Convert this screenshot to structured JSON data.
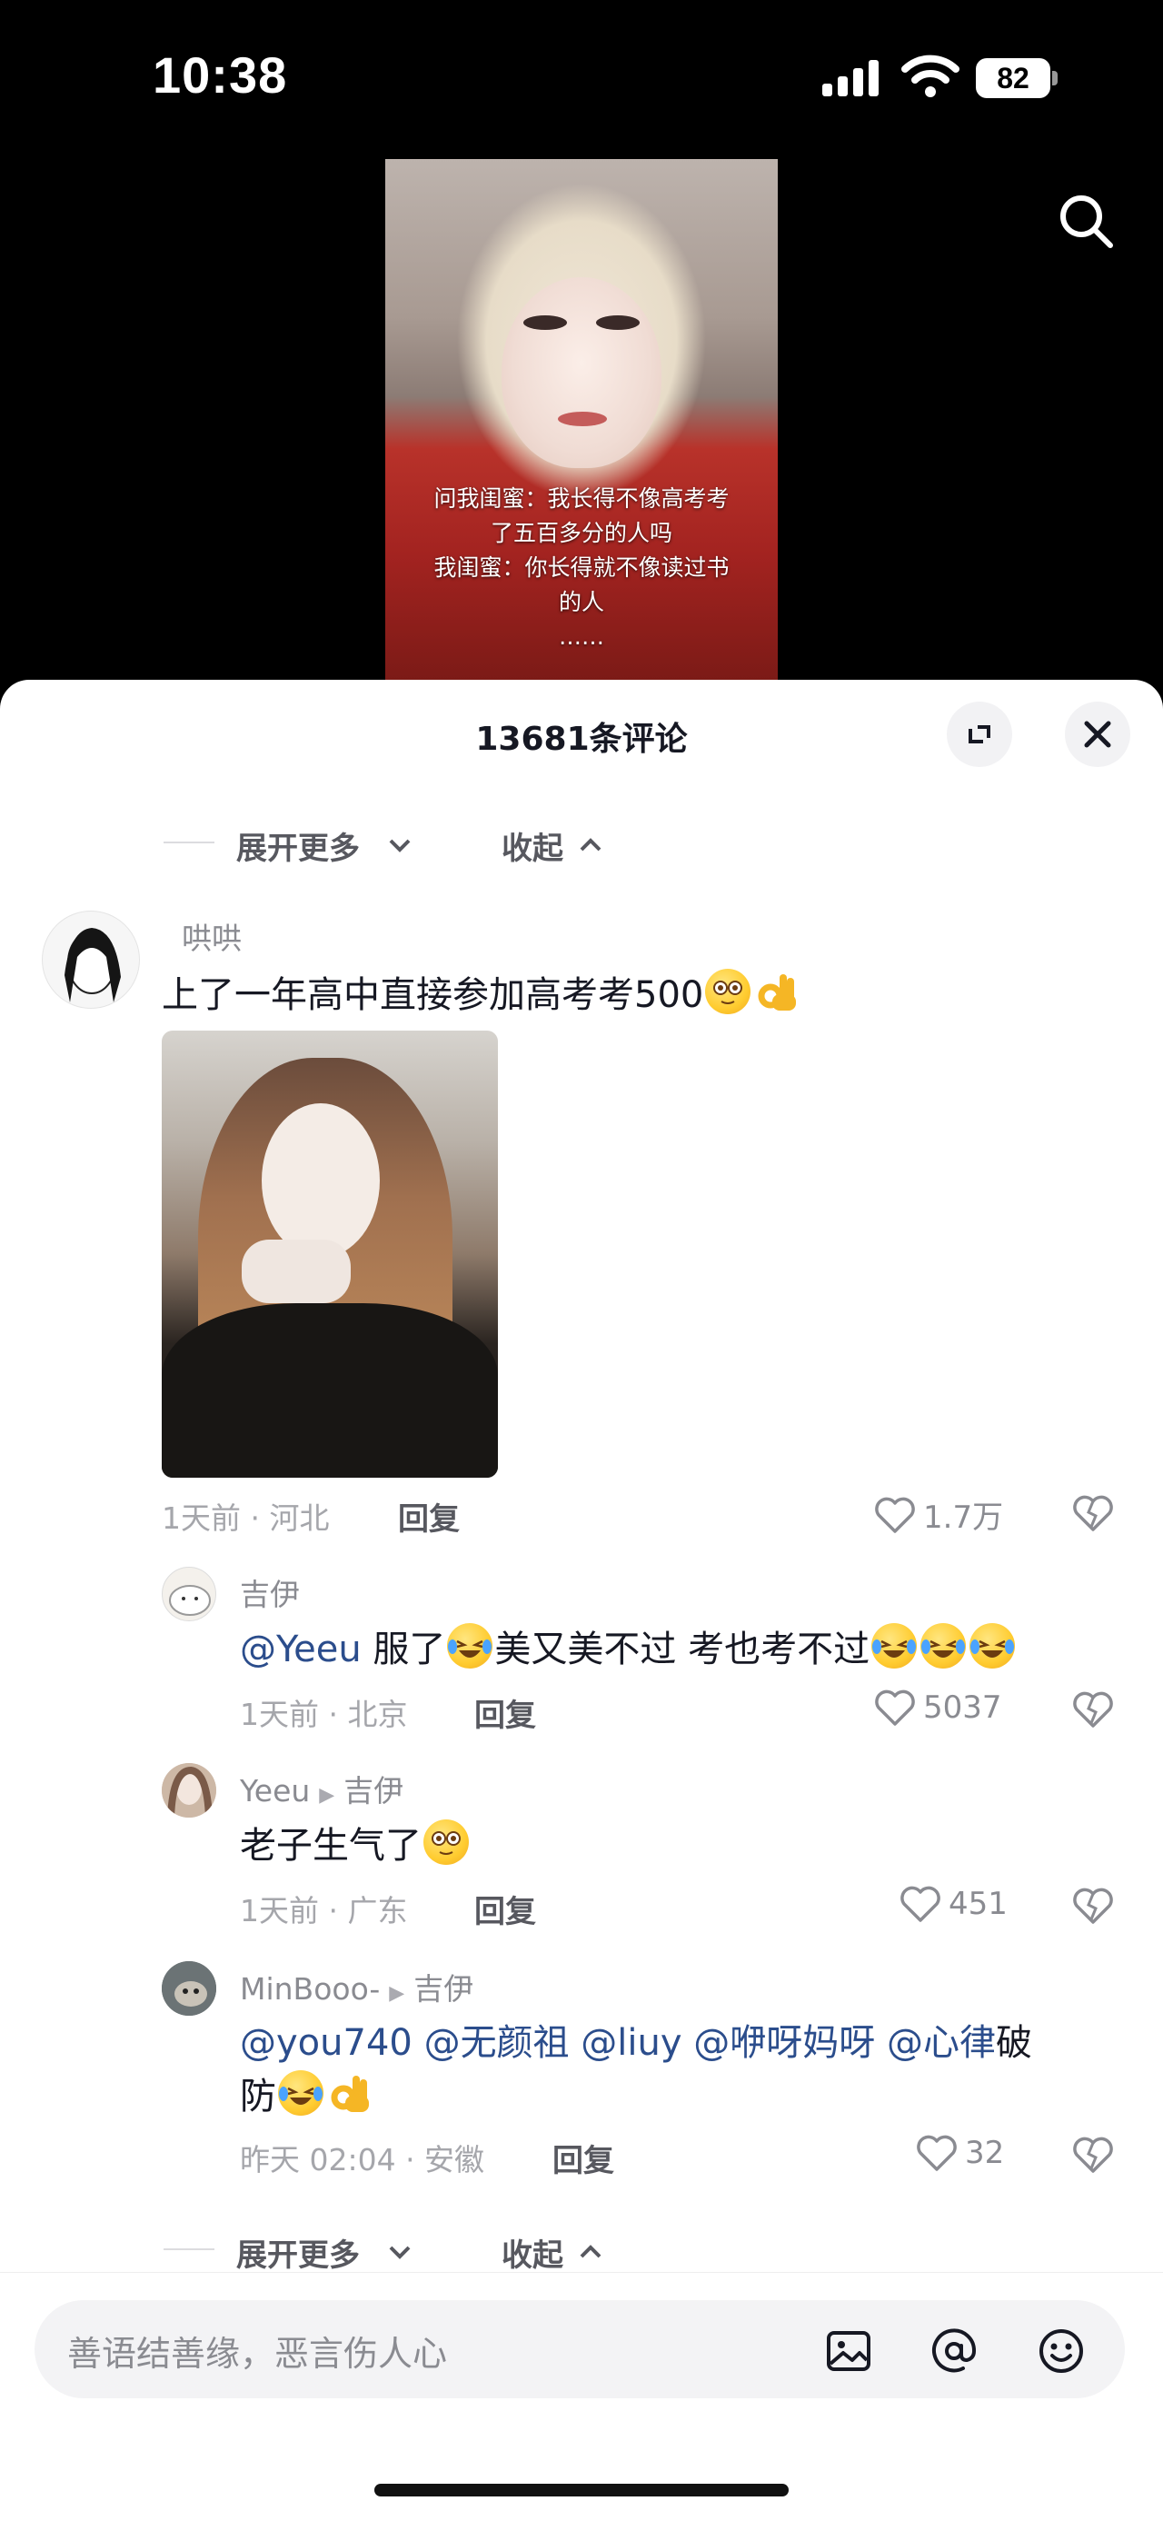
{
  "status_bar": {
    "time": "10:38",
    "battery": "82"
  },
  "video": {
    "caption_lines": [
      "问我闺蜜：我长得不像高考考",
      "了五百多分的人吗",
      "我闺蜜：你长得就不像读过书",
      "的人",
      "……"
    ]
  },
  "comments_panel": {
    "title": "13681条评论",
    "expand_more": "展开更多",
    "collapse": "收起",
    "main_comment": {
      "username": "哄哄",
      "text": "上了一年高中直接参加高考考500",
      "meta": "1天前 · 河北",
      "reply_label": "回复",
      "likes": "1.7万"
    },
    "replies": [
      {
        "username": "吉伊",
        "text_mention": "@Yeeu",
        "text_a": " 服了",
        "text_b": "美又美不过 考也考不过",
        "meta": "1天前 · 北京",
        "reply_label": "回复",
        "likes": "5037"
      },
      {
        "username": "Yeeu",
        "reply_to": "吉伊",
        "text": "老子生气了",
        "meta": "1天前 · 广东",
        "reply_label": "回复",
        "likes": "451"
      },
      {
        "username": "MinBooo-",
        "reply_to": "吉伊",
        "mentions": [
          "@you740",
          "@无颜祖",
          "@liuy",
          "@咿呀妈呀",
          "@心律"
        ],
        "text_tail": "破",
        "text_line2": "防",
        "meta": "昨天 02:04 · 安徽",
        "reply_label": "回复",
        "likes": "32"
      }
    ]
  },
  "input": {
    "placeholder": "善语结善缘，恶言伤人心"
  }
}
